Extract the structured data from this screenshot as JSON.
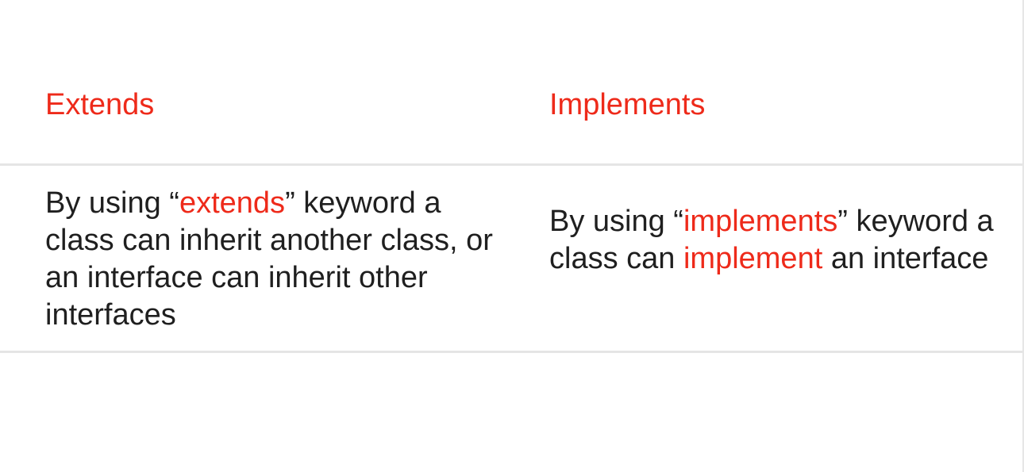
{
  "table": {
    "headers": [
      "Extends",
      "Implements"
    ],
    "rows": [
      {
        "extends": {
          "before": "By using “",
          "keyword": "extends",
          "after": "” keyword a class can inherit another class, or an interface can inherit other interfaces"
        },
        "implements": {
          "before": "By using “",
          "keyword": "implements",
          "middle": "” keyword a class can ",
          "keyword2": "implement",
          "after": " an interface"
        }
      }
    ]
  },
  "colors": {
    "accent": "#ee2a1a",
    "text": "#1f1f1f",
    "divider": "#e5e5e5"
  }
}
